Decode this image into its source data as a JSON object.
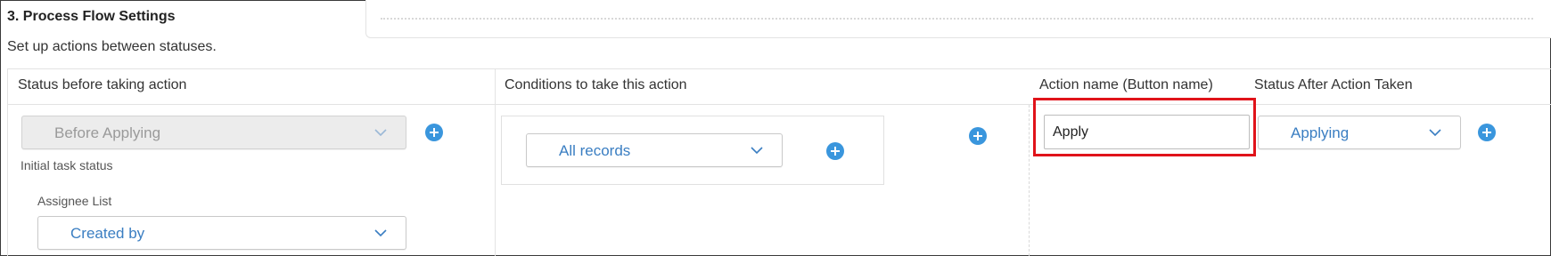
{
  "section": {
    "title": "3. Process Flow Settings",
    "subtitle": "Set up actions between statuses."
  },
  "table": {
    "headers": {
      "status_before": "Status before taking action",
      "conditions": "Conditions to take this action",
      "action_name": "Action name (Button name)",
      "status_after": "Status After Action Taken"
    },
    "row": {
      "status_before": {
        "value": "Before Applying",
        "disabled": true,
        "note": "Initial task status"
      },
      "assignee": {
        "label": "Assignee List",
        "value": "Created by"
      },
      "condition": {
        "value": "All records"
      },
      "action_name": {
        "value": "Apply",
        "highlighted": true
      },
      "status_after": {
        "value": "Applying"
      }
    }
  },
  "icons": {
    "add": "plus-circle-icon",
    "dropdown": "chevron-down-icon"
  },
  "colors": {
    "accent": "#3a96dd",
    "select_text": "#3a7ec2",
    "highlight": "#e0131a",
    "disabled_bg": "#ececec"
  }
}
